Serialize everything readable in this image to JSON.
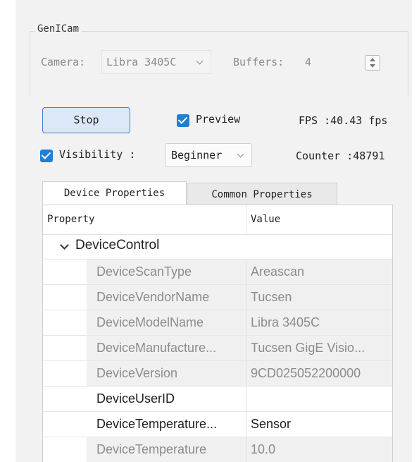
{
  "group": {
    "title": "GenICam"
  },
  "camera": {
    "label": "Camera:",
    "value": "Libra 3405C"
  },
  "buffers": {
    "label": "Buffers:",
    "value": "4"
  },
  "controls": {
    "stop_label": "Stop",
    "preview_label": "Preview",
    "preview_checked": true,
    "fps_text": "FPS :40.43 fps",
    "visibility_label": "Visibility :",
    "visibility_checked": true,
    "visibility_value": "Beginner",
    "counter_text": "Counter :48791"
  },
  "tabs": [
    {
      "label": "Device Properties",
      "active": true
    },
    {
      "label": "Common Properties",
      "active": false
    }
  ],
  "table": {
    "headers": [
      "Property",
      "Value"
    ],
    "category": "DeviceControl",
    "rows": [
      {
        "name": "DeviceScanType",
        "value": "Areascan",
        "editable": false
      },
      {
        "name": "DeviceVendorName",
        "value": "Tucsen",
        "editable": false
      },
      {
        "name": "DeviceModelName",
        "value": "Libra 3405C",
        "editable": false
      },
      {
        "name": "DeviceManufacture...",
        "value": "Tucsen GigE Visio...",
        "editable": false
      },
      {
        "name": "DeviceVersion",
        "value": "9CD025052200000",
        "editable": false
      },
      {
        "name": "DeviceUserID",
        "value": "",
        "editable": true
      },
      {
        "name": "DeviceTemperature...",
        "value": "Sensor",
        "editable": true
      },
      {
        "name": "DeviceTemperature",
        "value": "10.0",
        "editable": false
      }
    ]
  },
  "colors": {
    "accent": "#1e7fd6",
    "button_bg": "#dce8f8",
    "panel_bg": "#f2f2f2",
    "readonly_text": "#8c8c8c"
  }
}
